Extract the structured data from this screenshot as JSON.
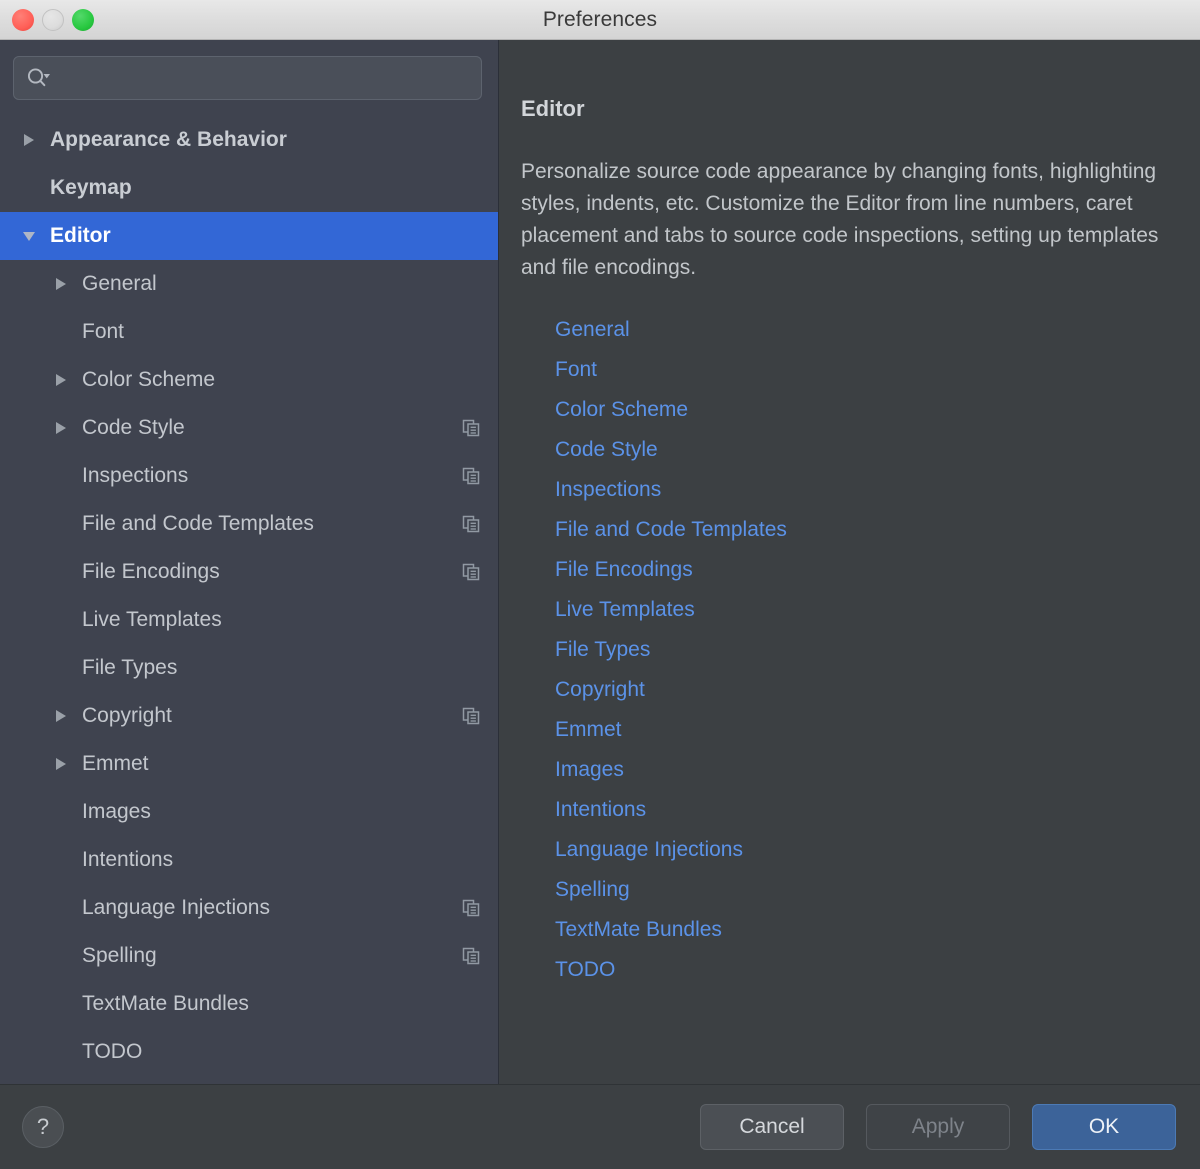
{
  "window": {
    "title": "Preferences",
    "traffic_lights": [
      "close",
      "minimize",
      "maximize"
    ]
  },
  "search": {
    "value": "",
    "placeholder": "",
    "icon": "search-icon"
  },
  "sidebar": {
    "items": [
      {
        "label": "Appearance & Behavior",
        "depth": 0,
        "arrow": "collapsed",
        "bold": true,
        "selected": false,
        "copy": false
      },
      {
        "label": "Keymap",
        "depth": 0,
        "arrow": "none",
        "bold": true,
        "selected": false,
        "copy": false
      },
      {
        "label": "Editor",
        "depth": 0,
        "arrow": "expanded",
        "bold": true,
        "selected": true,
        "copy": false
      },
      {
        "label": "General",
        "depth": 1,
        "arrow": "collapsed",
        "bold": false,
        "selected": false,
        "copy": false
      },
      {
        "label": "Font",
        "depth": 1,
        "arrow": "none",
        "bold": false,
        "selected": false,
        "copy": false
      },
      {
        "label": "Color Scheme",
        "depth": 1,
        "arrow": "collapsed",
        "bold": false,
        "selected": false,
        "copy": false
      },
      {
        "label": "Code Style",
        "depth": 1,
        "arrow": "collapsed",
        "bold": false,
        "selected": false,
        "copy": true
      },
      {
        "label": "Inspections",
        "depth": 1,
        "arrow": "none",
        "bold": false,
        "selected": false,
        "copy": true
      },
      {
        "label": "File and Code Templates",
        "depth": 1,
        "arrow": "none",
        "bold": false,
        "selected": false,
        "copy": true
      },
      {
        "label": "File Encodings",
        "depth": 1,
        "arrow": "none",
        "bold": false,
        "selected": false,
        "copy": true
      },
      {
        "label": "Live Templates",
        "depth": 1,
        "arrow": "none",
        "bold": false,
        "selected": false,
        "copy": false
      },
      {
        "label": "File Types",
        "depth": 1,
        "arrow": "none",
        "bold": false,
        "selected": false,
        "copy": false
      },
      {
        "label": "Copyright",
        "depth": 1,
        "arrow": "collapsed",
        "bold": false,
        "selected": false,
        "copy": true
      },
      {
        "label": "Emmet",
        "depth": 1,
        "arrow": "collapsed",
        "bold": false,
        "selected": false,
        "copy": false
      },
      {
        "label": "Images",
        "depth": 1,
        "arrow": "none",
        "bold": false,
        "selected": false,
        "copy": false
      },
      {
        "label": "Intentions",
        "depth": 1,
        "arrow": "none",
        "bold": false,
        "selected": false,
        "copy": false
      },
      {
        "label": "Language Injections",
        "depth": 1,
        "arrow": "none",
        "bold": false,
        "selected": false,
        "copy": true
      },
      {
        "label": "Spelling",
        "depth": 1,
        "arrow": "none",
        "bold": false,
        "selected": false,
        "copy": true
      },
      {
        "label": "TextMate Bundles",
        "depth": 1,
        "arrow": "none",
        "bold": false,
        "selected": false,
        "copy": false
      },
      {
        "label": "TODO",
        "depth": 1,
        "arrow": "none",
        "bold": false,
        "selected": false,
        "copy": false
      }
    ]
  },
  "detail": {
    "title": "Editor",
    "description": "Personalize source code appearance by changing fonts, highlighting styles, indents, etc. Customize the Editor from line numbers, caret placement and tabs to source code inspections, setting up templates and file encodings.",
    "links": [
      "General",
      "Font",
      "Color Scheme",
      "Code Style",
      "Inspections",
      "File and Code Templates",
      "File Encodings",
      "Live Templates",
      "File Types",
      "Copyright",
      "Emmet",
      "Images",
      "Intentions",
      "Language Injections",
      "Spelling",
      "TextMate Bundles",
      "TODO"
    ]
  },
  "footer": {
    "help_label": "?",
    "buttons": [
      {
        "label": "Cancel",
        "state": "normal",
        "name": "cancel-button"
      },
      {
        "label": "Apply",
        "state": "disabled",
        "name": "apply-button"
      },
      {
        "label": "OK",
        "state": "primary",
        "name": "ok-button"
      }
    ]
  },
  "colors": {
    "sidebar_bg": "#3f434f",
    "panel_bg": "#3c4043",
    "selection": "#3367d6",
    "link": "#5b92e8",
    "primary_button": "#3c6399",
    "text": "#c3c7cd",
    "titlebar": "#dcdcdc"
  }
}
